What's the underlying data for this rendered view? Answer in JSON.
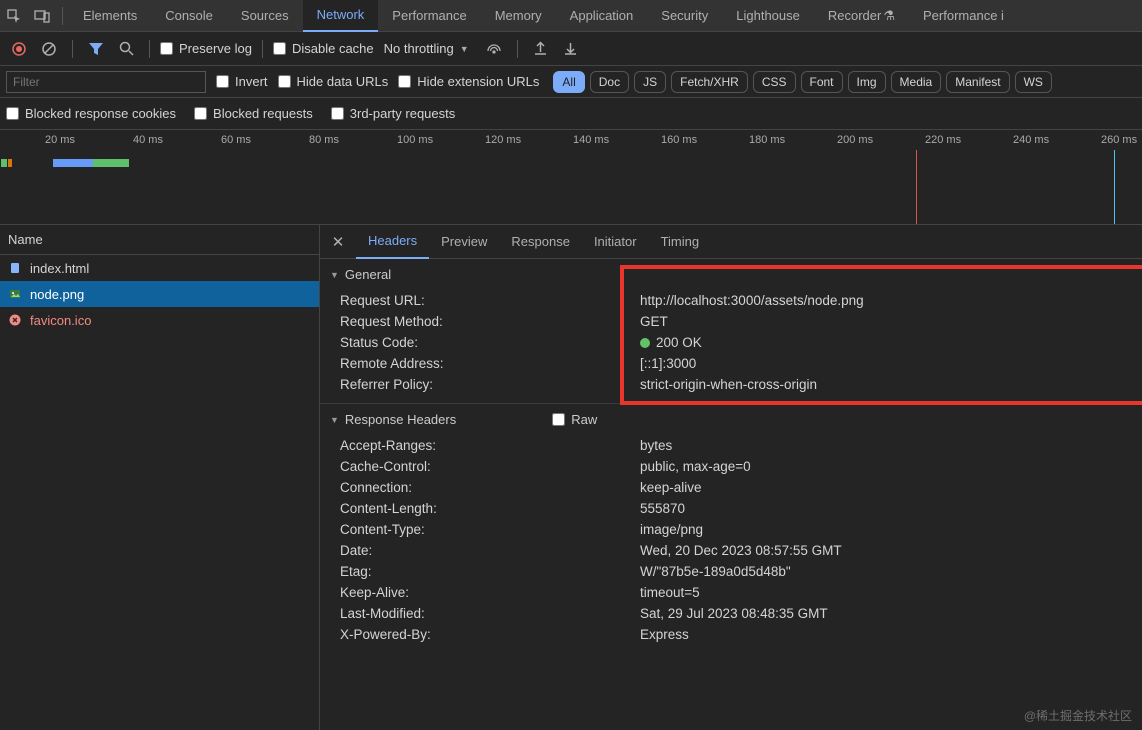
{
  "top_tabs": [
    "Elements",
    "Console",
    "Sources",
    "Network",
    "Performance",
    "Memory",
    "Application",
    "Security",
    "Lighthouse",
    "Recorder",
    "Performance i"
  ],
  "top_active": "Network",
  "toolbar": {
    "preserve_log": "Preserve log",
    "disable_cache": "Disable cache",
    "throttling": "No throttling"
  },
  "filter": {
    "placeholder": "Filter",
    "invert": "Invert",
    "hide_data": "Hide data URLs",
    "hide_ext": "Hide extension URLs"
  },
  "type_chips": [
    "All",
    "Doc",
    "JS",
    "Fetch/XHR",
    "CSS",
    "Font",
    "Img",
    "Media",
    "Manifest",
    "WS"
  ],
  "type_active": "All",
  "row3": {
    "blocked_cookies": "Blocked response cookies",
    "blocked_req": "Blocked requests",
    "third_party": "3rd-party requests"
  },
  "timeline_labels": [
    "20 ms",
    "40 ms",
    "60 ms",
    "80 ms",
    "100 ms",
    "120 ms",
    "140 ms",
    "160 ms",
    "180 ms",
    "200 ms",
    "220 ms",
    "240 ms",
    "260 ms"
  ],
  "list_header": "Name",
  "requests": [
    {
      "name": "index.html",
      "icon": "doc",
      "selected": false,
      "error": false
    },
    {
      "name": "node.png",
      "icon": "img",
      "selected": true,
      "error": false
    },
    {
      "name": "favicon.ico",
      "icon": "err",
      "selected": false,
      "error": true
    }
  ],
  "detail_tabs": [
    "Headers",
    "Preview",
    "Response",
    "Initiator",
    "Timing"
  ],
  "detail_active": "Headers",
  "general": {
    "title": "General",
    "items": [
      {
        "k": "Request URL:",
        "v": "http://localhost:3000/assets/node.png"
      },
      {
        "k": "Request Method:",
        "v": "GET"
      },
      {
        "k": "Status Code:",
        "v": "200 OK",
        "dot": true
      },
      {
        "k": "Remote Address:",
        "v": "[::1]:3000"
      },
      {
        "k": "Referrer Policy:",
        "v": "strict-origin-when-cross-origin"
      }
    ]
  },
  "response_headers": {
    "title": "Response Headers",
    "raw_label": "Raw",
    "items": [
      {
        "k": "Accept-Ranges:",
        "v": "bytes"
      },
      {
        "k": "Cache-Control:",
        "v": "public, max-age=0"
      },
      {
        "k": "Connection:",
        "v": "keep-alive"
      },
      {
        "k": "Content-Length:",
        "v": "555870"
      },
      {
        "k": "Content-Type:",
        "v": "image/png"
      },
      {
        "k": "Date:",
        "v": "Wed, 20 Dec 2023 08:57:55 GMT"
      },
      {
        "k": "Etag:",
        "v": "W/\"87b5e-189a0d5d48b\""
      },
      {
        "k": "Keep-Alive:",
        "v": "timeout=5"
      },
      {
        "k": "Last-Modified:",
        "v": "Sat, 29 Jul 2023 08:48:35 GMT"
      },
      {
        "k": "X-Powered-By:",
        "v": "Express"
      }
    ]
  },
  "watermark": "@稀土掘金技术社区"
}
